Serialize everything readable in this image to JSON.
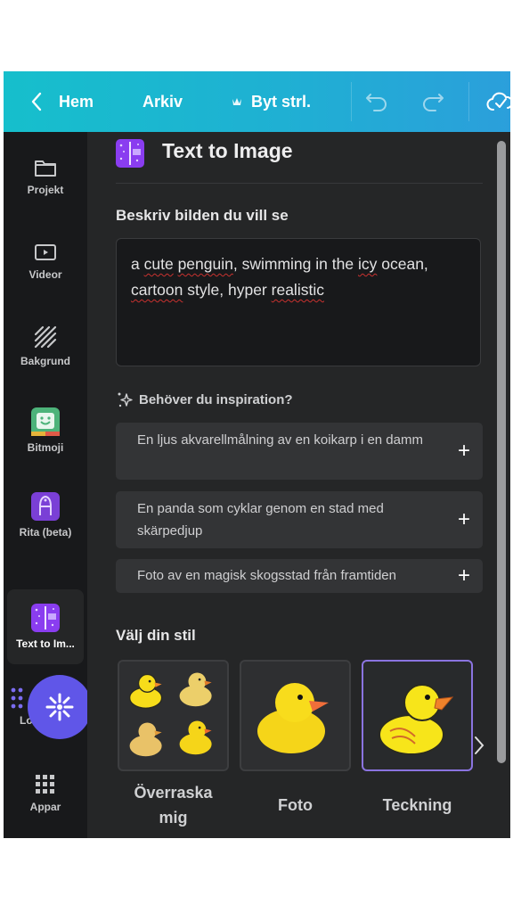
{
  "topbar": {
    "back_label": "Hem",
    "file_label": "Arkiv",
    "resize_label": "Byt strl.",
    "icons": [
      "chevron-left-icon",
      "crown-icon",
      "undo-icon",
      "redo-icon",
      "cloud-check-icon"
    ]
  },
  "sidebar": {
    "items": [
      {
        "label": "Projekt",
        "icon": "folder-icon"
      },
      {
        "label": "Videor",
        "icon": "video-icon"
      },
      {
        "label": "Bakgrund",
        "icon": "stripes-icon"
      },
      {
        "label": "Bitmoji",
        "icon": "bitmoji-icon"
      },
      {
        "label": "Rita (beta)",
        "icon": "draw-icon"
      },
      {
        "label": "Text to Im...",
        "icon": "text-to-image-icon",
        "active": true
      },
      {
        "label": "Logo",
        "icon": "dots-icon"
      },
      {
        "label": "Appar",
        "icon": "apps-grid-icon"
      }
    ]
  },
  "panel": {
    "title": "Text to Image",
    "describe_label": "Beskriv bilden du vill se",
    "prompt_value": "a cute penguin, swimming in the icy ocean, cartoon style, hyper realistic",
    "inspiration_label": "Behöver du inspiration?",
    "suggestions": [
      "En ljus akvarellmålning av en koikarp i en damm",
      "En panda som cyklar genom en stad med skärpedjup",
      "Foto av en magisk skogsstad från framtiden"
    ],
    "style_label": "Välj din stil",
    "styles": [
      {
        "name": "Överraska mig",
        "selected": false
      },
      {
        "name": "Foto",
        "selected": false
      },
      {
        "name": "Teckning",
        "selected": true
      }
    ]
  },
  "colors": {
    "topbar_start": "#16bfcc",
    "topbar_end": "#2b9fdb",
    "accent_purple": "#8b74e0",
    "fab": "#6056e8"
  }
}
